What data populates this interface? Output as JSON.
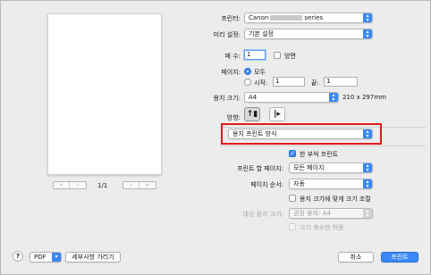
{
  "preview": {
    "nav_first": "«",
    "nav_prev": "‹",
    "page_count": "1/1",
    "nav_next": "›",
    "nav_last": "»"
  },
  "printer": {
    "label": "프린터:",
    "value_prefix": "Canon",
    "value_suffix": "series"
  },
  "presets": {
    "label": "미리 설정:",
    "value": "기본 설정"
  },
  "copies": {
    "label": "매 수:",
    "value": "1",
    "two_sided_label": "양면"
  },
  "pages": {
    "label": "페이지:",
    "all_label": "모두",
    "from_label": "시작:",
    "from_value": "1",
    "to_label": "끝:",
    "to_value": "1"
  },
  "paper_size": {
    "label": "용지 크기:",
    "value": "A4",
    "dimensions": "210 x 297mm"
  },
  "orientation": {
    "label": "방향:"
  },
  "section_menu": {
    "value": "용지 프린트 방식"
  },
  "collate": {
    "label": "한 부씩 프린트"
  },
  "pages_to_print": {
    "label": "프린트 할 페이지:",
    "value": "모든 페이지"
  },
  "page_order": {
    "label": "페이지 순서:",
    "value": "자동"
  },
  "scale_to_fit": {
    "label": "용지 크기에 맞게 크기 조절"
  },
  "destination_paper": {
    "label": "대상 용지 크기:",
    "value": "권장 용지: A4"
  },
  "scale_down_only": {
    "label": "크기 축소만 허용"
  },
  "footer": {
    "help": "?",
    "pdf_label": "PDF",
    "hide_details_label": "세부사항 가리기",
    "cancel_label": "취소",
    "print_label": "프린트"
  },
  "colors": {
    "accent": "#3a88f5",
    "highlight": "#e01b1b"
  }
}
